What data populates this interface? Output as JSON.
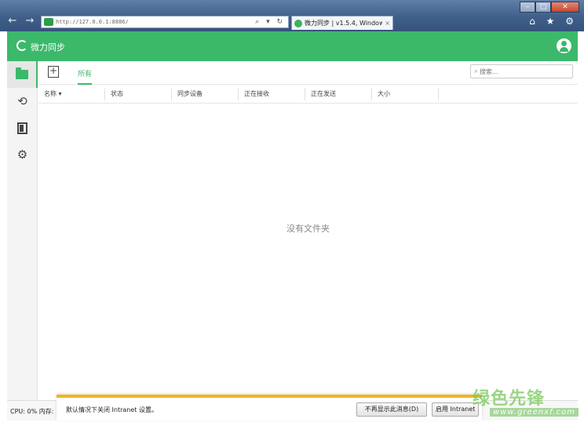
{
  "browser": {
    "url": "http://127.0.0.1:8886/",
    "tab_title": "微力同步 | v1.5.4, Window...",
    "tab_close": "×",
    "search_refresh": "⌕ ▾ ↻",
    "right_icons": "⌂ ★ ⚙",
    "win_controls": {
      "minimize": "–",
      "maximize": "□",
      "close": "✕"
    }
  },
  "app": {
    "title": "微力同步"
  },
  "sidebar": {
    "items": [
      {
        "name": "folders",
        "icon": "folder-icon",
        "active": true
      },
      {
        "name": "history",
        "icon": "history-icon",
        "glyph": "⟲"
      },
      {
        "name": "devices",
        "icon": "door-icon"
      },
      {
        "name": "settings",
        "icon": "gear-icon",
        "glyph": "⚙"
      }
    ]
  },
  "toolbar": {
    "add_glyph": "+",
    "tab_all": "所有",
    "search_placeholder": "搜索..."
  },
  "table": {
    "columns": [
      "名称 ▾",
      "状态",
      "同步设备",
      "正在接收",
      "正在发送",
      "大小",
      ""
    ]
  },
  "main": {
    "empty_text": "没有文件夹"
  },
  "status": {
    "text": "CPU: 0% 内存:"
  },
  "notification": {
    "message": "默认情况下关闭 Intranet 设置。",
    "btn_dont_show": "不再显示此消息(D)",
    "btn_enable": "启用 Intranet"
  },
  "watermark": {
    "big": "绿色先锋",
    "small": "www.greenxf.com"
  },
  "colors": {
    "accent": "#3cb86b",
    "notification_bar": "#f3b51b"
  }
}
